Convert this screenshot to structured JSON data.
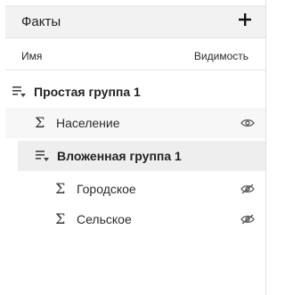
{
  "header": {
    "title": "Факты",
    "add_icon": "plus-icon"
  },
  "columns": {
    "name": "Имя",
    "visibility": "Видимость"
  },
  "tree": {
    "group1": {
      "label": "Простая группа 1",
      "icon": "group-collapse-icon"
    },
    "item_population": {
      "label": "Население",
      "icon": "sigma-icon",
      "visible": true
    },
    "group2": {
      "label": "Вложенная группа 1",
      "icon": "group-collapse-icon"
    },
    "item_urban": {
      "label": "Городское",
      "icon": "sigma-icon",
      "visible": false
    },
    "item_rural": {
      "label": "Сельское",
      "icon": "sigma-icon",
      "visible": false
    }
  },
  "sigma_glyph": "Σ"
}
